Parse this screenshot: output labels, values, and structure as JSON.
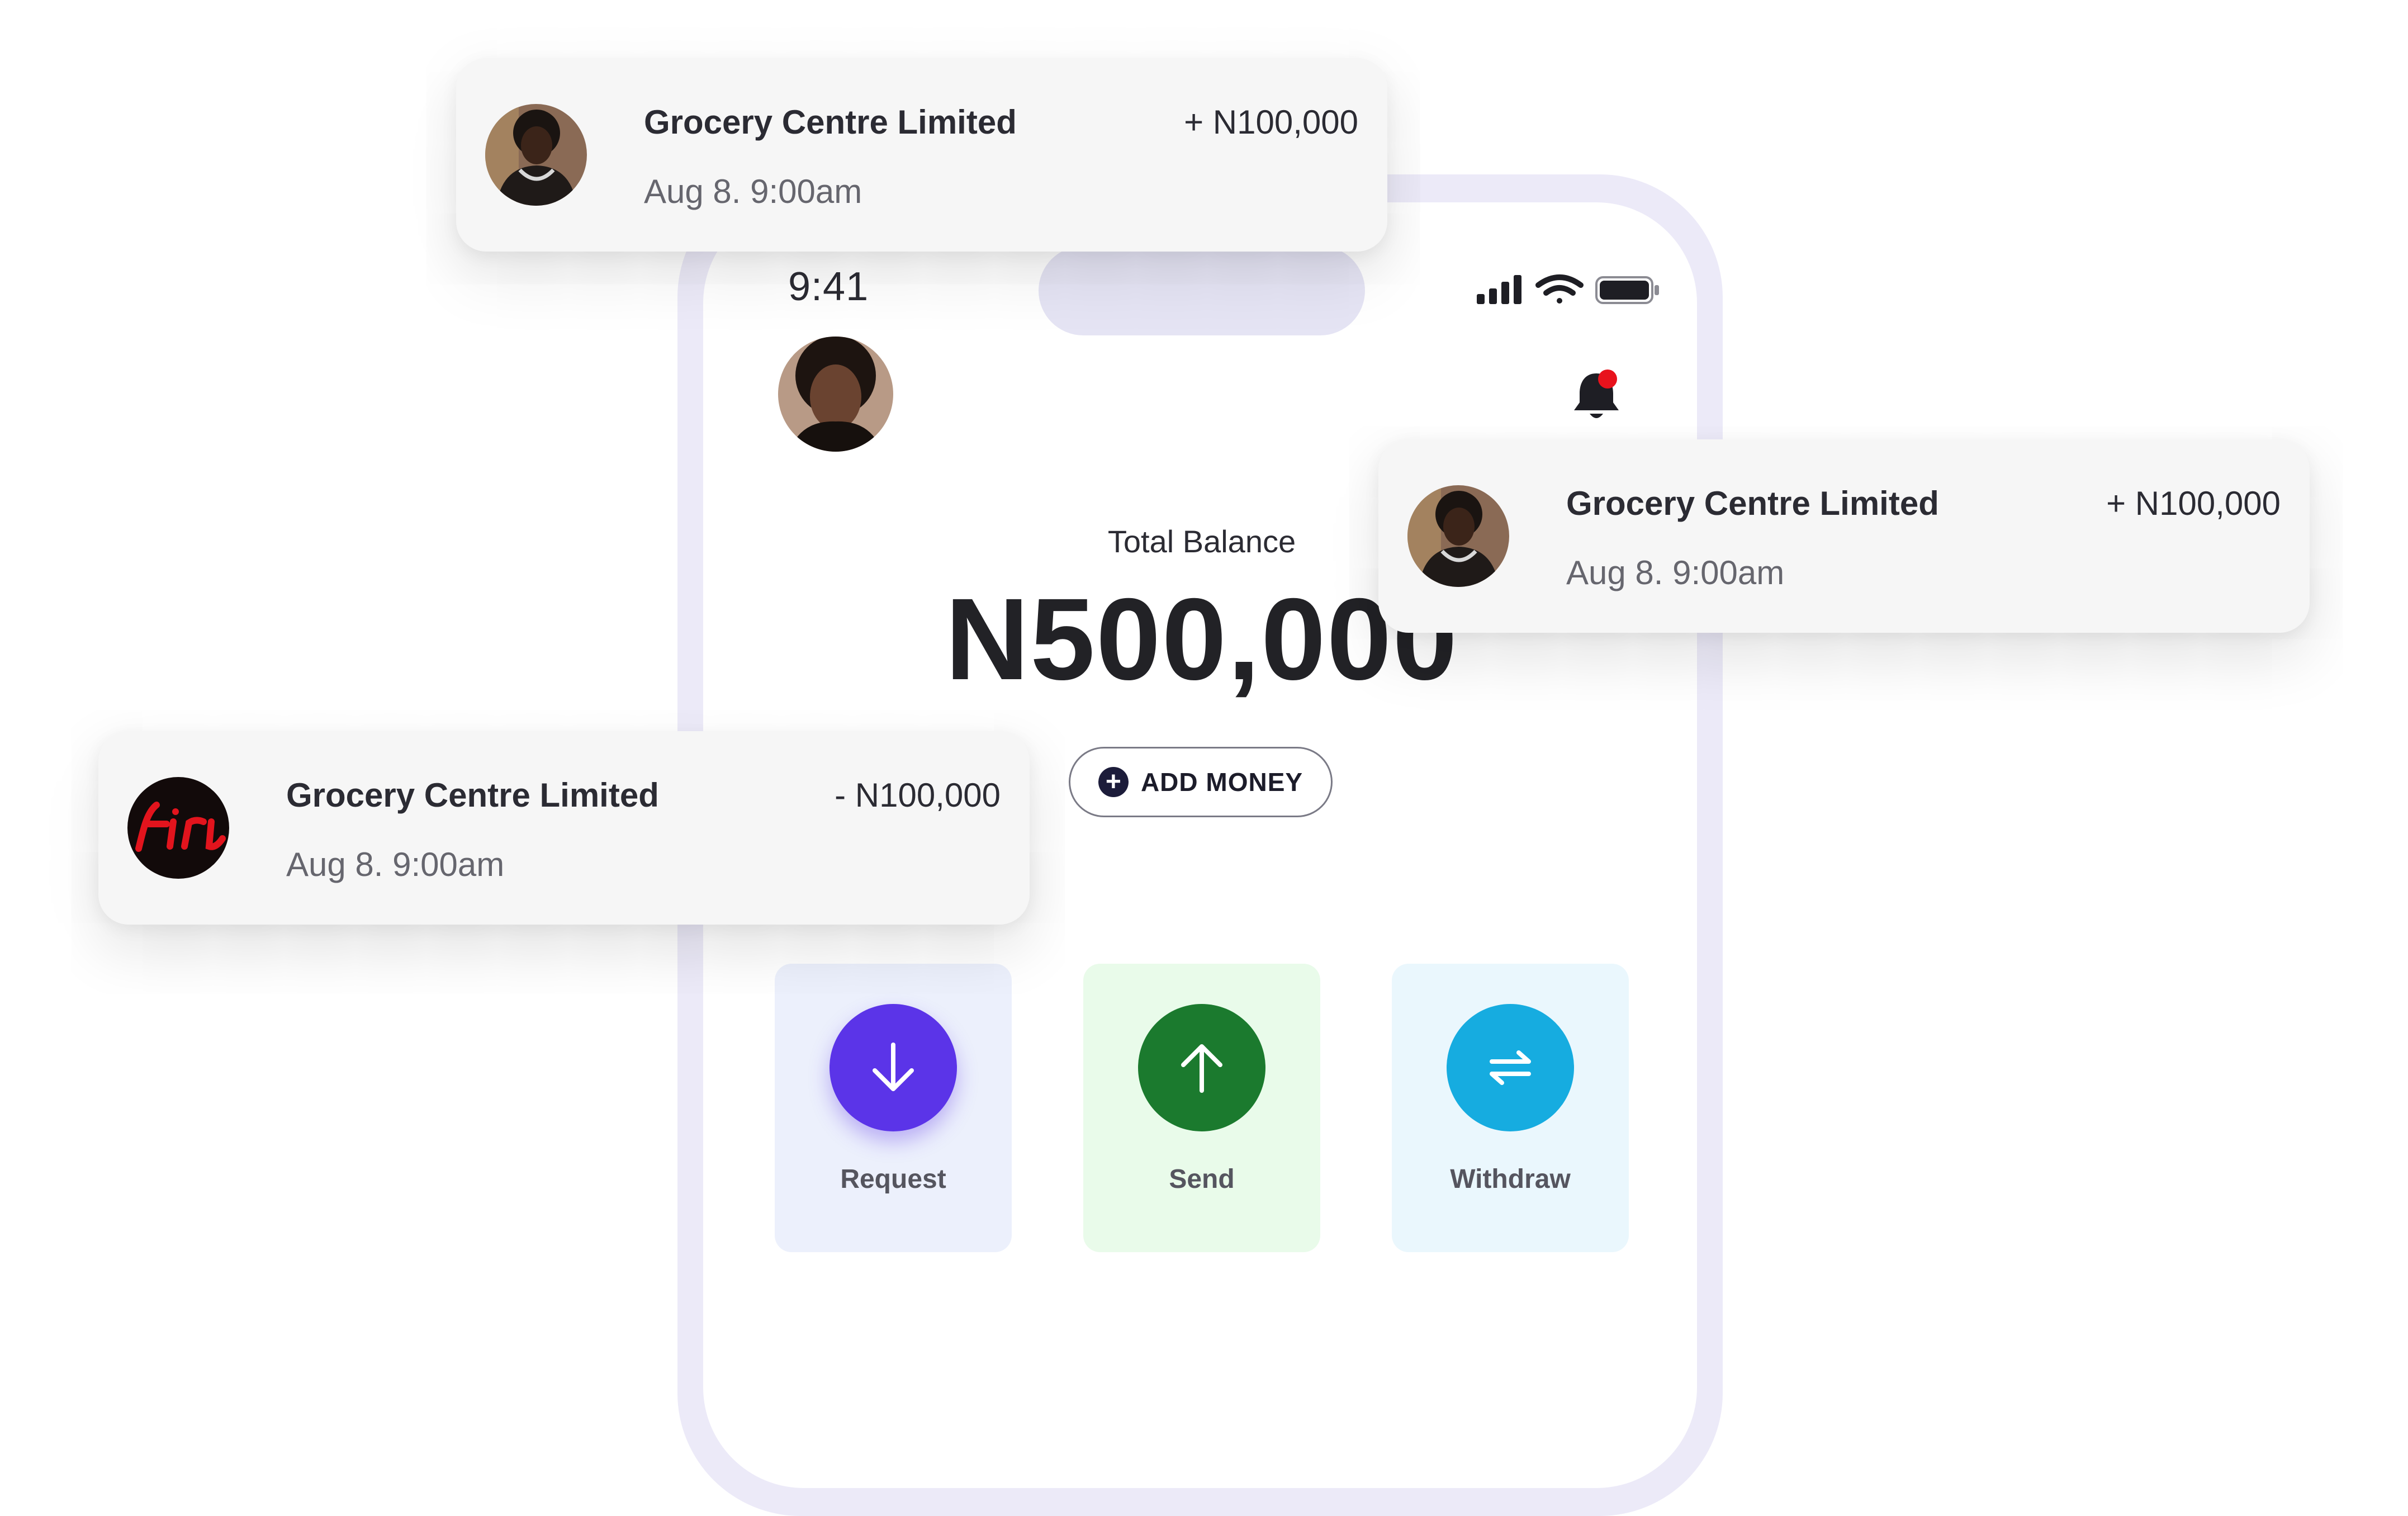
{
  "phone": {
    "status_time": "9:41",
    "total_balance_label": "Total Balance",
    "total_balance_value": "N500,000",
    "add_money_label": "ADD MONEY",
    "actions": [
      {
        "label": "Request",
        "icon": "arrow-down-icon",
        "color": "#5b34e8"
      },
      {
        "label": "Send",
        "icon": "arrow-up-icon",
        "color": "#1b7a2e"
      },
      {
        "label": "Withdraw",
        "icon": "swap-arrows-icon",
        "color": "#16ace0"
      }
    ],
    "notification_dot_color": "#e8121c"
  },
  "notifications": [
    {
      "merchant": "Grocery Centre Limited",
      "amount": "+ N100,000",
      "time": "Aug 8.  9:00am",
      "avatar": "person-photo"
    },
    {
      "merchant": "Grocery Centre Limited",
      "amount": "+ N100,000",
      "time": "Aug 8.  9:00am",
      "avatar": "person-photo"
    },
    {
      "merchant": "Grocery Centre Limited",
      "amount": "- N100,000",
      "time": "Aug 8.  9:00am",
      "avatar": "neon-sign-logo"
    }
  ]
}
